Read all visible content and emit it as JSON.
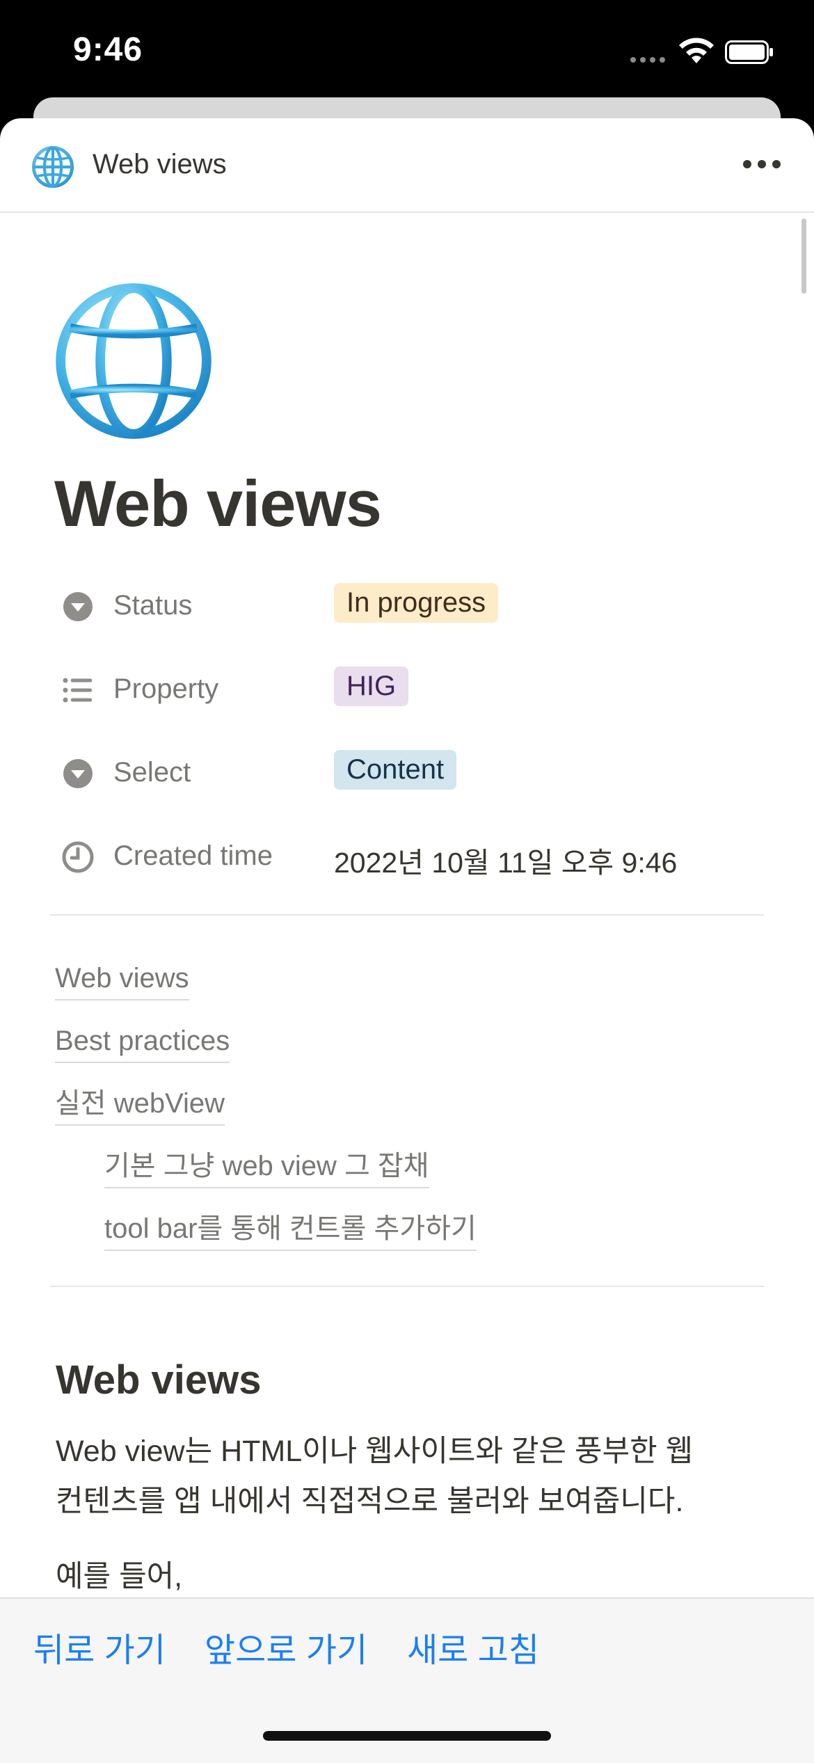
{
  "status_bar": {
    "time": "9:46"
  },
  "topbar": {
    "title": "Web views",
    "icon": "globe-icon",
    "menu_icon": "more-icon"
  },
  "page": {
    "icon": "globe-icon",
    "title": "Web views",
    "properties": [
      {
        "icon": "select-circle-icon",
        "label": "Status",
        "value": "In progress",
        "tag_color": "#fdecc8"
      },
      {
        "icon": "list-icon",
        "label": "Property",
        "value": "HIG",
        "tag_color": "#e8deee"
      },
      {
        "icon": "select-circle-icon",
        "label": "Select",
        "value": "Content",
        "tag_color": "#d3e5ef"
      },
      {
        "icon": "clock-icon",
        "label": "Created time",
        "value": "2022년 10월 11일 오후 9:46"
      }
    ],
    "toc": [
      {
        "label": "Web views"
      },
      {
        "label": "Best practices"
      },
      {
        "label": "실전 webView"
      },
      {
        "label": "기본 그냥 web view 그 잡채"
      },
      {
        "label": "tool bar를 통해 컨트롤 추가하기"
      }
    ],
    "section_heading": "Web views",
    "paragraph_line1": "Web view는 HTML이나 웹사이트와 같은 풍부한 웹",
    "paragraph_line2": "컨텐츠를 앱 내에서 직접적으로 불러와 보여줍니다.",
    "paragraph2": "예를 들어,"
  },
  "toolbar": {
    "back_label": "뒤로 가기",
    "forward_label": "앞으로 가기",
    "refresh_label": "새로 고침",
    "accent_color": "#1a7ff2"
  }
}
